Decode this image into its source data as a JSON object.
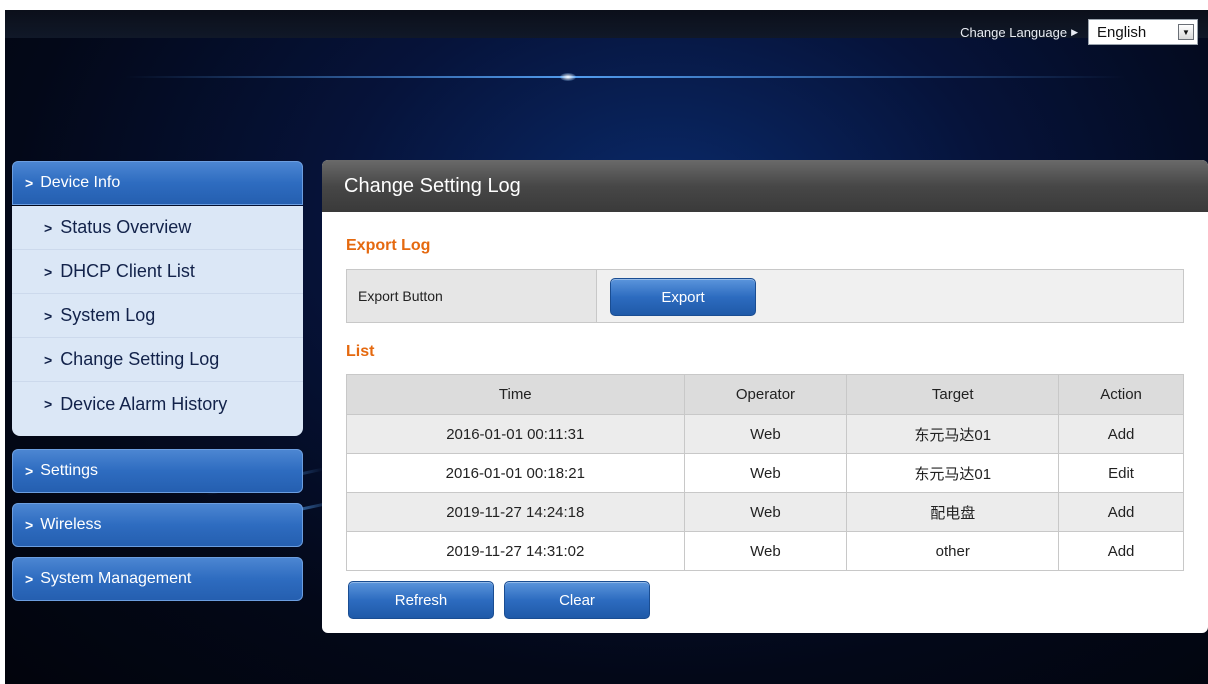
{
  "header": {
    "change_language_label": "Change Language",
    "language_selected": "English"
  },
  "sidebar": {
    "sections": [
      {
        "label": "Device Info",
        "expanded": true
      },
      {
        "label": "Settings",
        "expanded": false
      },
      {
        "label": "Wireless",
        "expanded": false
      },
      {
        "label": "System Management",
        "expanded": false
      }
    ],
    "device_info_items": [
      {
        "label": "Status Overview"
      },
      {
        "label": "DHCP Client List"
      },
      {
        "label": "System Log"
      },
      {
        "label": "Change Setting Log"
      },
      {
        "label": "Device Alarm History"
      }
    ]
  },
  "main": {
    "title": "Change Setting Log",
    "export_section_title": "Export Log",
    "export_label": "Export Button",
    "export_button": "Export",
    "list_section_title": "List",
    "table": {
      "columns": [
        "Time",
        "Operator",
        "Target",
        "Action"
      ],
      "rows": [
        [
          "2016-01-01 00:11:31",
          "Web",
          "东元马达01",
          "Add"
        ],
        [
          "2016-01-01 00:18:21",
          "Web",
          "东元马达01",
          "Edit"
        ],
        [
          "2019-11-27 14:24:18",
          "Web",
          "配电盘",
          "Add"
        ],
        [
          "2019-11-27 14:31:02",
          "Web",
          "other",
          "Add"
        ]
      ]
    },
    "refresh_button": "Refresh",
    "clear_button": "Clear"
  },
  "colors": {
    "accent_orange": "#e5690f",
    "menu_blue": "#2e6cc0",
    "submenu_bg": "#dbe7f6",
    "panel_header": "#474747"
  }
}
